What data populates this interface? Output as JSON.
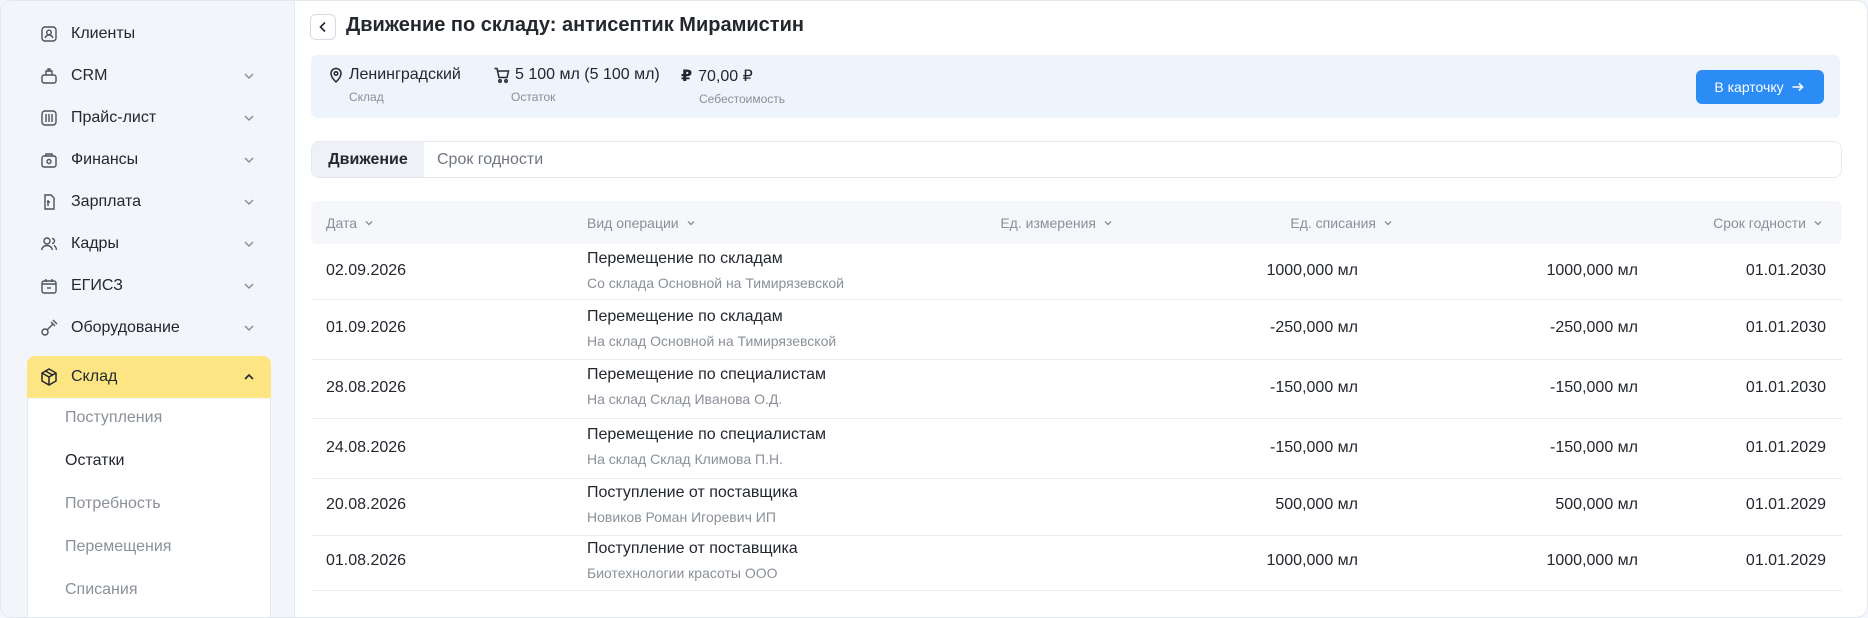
{
  "sidebar": {
    "items": [
      {
        "label": "Клиенты",
        "icon": "clients-icon",
        "has_chevron": false
      },
      {
        "label": "CRM",
        "icon": "crm-icon",
        "has_chevron": true
      },
      {
        "label": "Прайс-лист",
        "icon": "price-list-icon",
        "has_chevron": true
      },
      {
        "label": "Финансы",
        "icon": "finance-icon",
        "has_chevron": true
      },
      {
        "label": "Зарплата",
        "icon": "salary-icon",
        "has_chevron": true
      },
      {
        "label": "Кадры",
        "icon": "staff-icon",
        "has_chevron": true
      },
      {
        "label": "ЕГИСЗ",
        "icon": "egisz-icon",
        "has_chevron": true
      },
      {
        "label": "Оборудование",
        "icon": "equipment-icon",
        "has_chevron": true
      },
      {
        "label": "Склад",
        "icon": "warehouse-icon",
        "has_chevron": true,
        "active": true
      }
    ],
    "submenu": [
      {
        "label": "Поступления"
      },
      {
        "label": "Остатки",
        "current": true
      },
      {
        "label": "Потребность"
      },
      {
        "label": "Перемещения"
      },
      {
        "label": "Списания"
      }
    ]
  },
  "header": {
    "title": "Движение по складу: антисептик Мирамистин"
  },
  "info": {
    "warehouse_value": "Ленинградский",
    "warehouse_label": "Склад",
    "stock_value": "5 100 мл (5 100 мл)",
    "stock_label": "Остаток",
    "cost_value": "70,00 ₽",
    "cost_label": "Себестоимость",
    "card_button": "В карточку"
  },
  "tabs": {
    "movement": "Движение",
    "expiry": "Срок годности"
  },
  "table": {
    "columns": {
      "date": "Дата",
      "operation": "Вид операции",
      "unit": "Ед. измерения",
      "writeoff": "Ед. списания",
      "expiry": "Срок годности"
    },
    "rows": [
      {
        "date": "02.09.2026",
        "op": "Перемещение по складам",
        "op_sub": "Со склада Основной на Тимирязевской",
        "unit": "1000,000 мл",
        "writeoff": "1000,000 мл",
        "expiry": "01.01.2030"
      },
      {
        "date": "01.09.2026",
        "op": "Перемещение по складам",
        "op_sub": "На склад Основной на Тимирязевской",
        "unit": "-250,000 мл",
        "writeoff": "-250,000 мл",
        "expiry": "01.01.2030"
      },
      {
        "date": "28.08.2026",
        "op": "Перемещение по специалистам",
        "op_sub": "На склад Склад Иванова О.Д.",
        "unit": "-150,000 мл",
        "writeoff": "-150,000 мл",
        "expiry": "01.01.2030"
      },
      {
        "date": "24.08.2026",
        "op": "Перемещение по специалистам",
        "op_sub": "На склад Склад Климова П.Н.",
        "unit": "-150,000 мл",
        "writeoff": "-150,000 мл",
        "expiry": "01.01.2029"
      },
      {
        "date": "20.08.2026",
        "op": "Поступление от поставщика",
        "op_sub": "Новиков Роман Игоревич ИП",
        "unit": "500,000 мл",
        "writeoff": "500,000 мл",
        "expiry": "01.01.2029"
      },
      {
        "date": "01.08.2026",
        "op": "Поступление от поставщика",
        "op_sub": "Биотехнологии красоты ООО",
        "unit": "1000,000 мл",
        "writeoff": "1000,000 мл",
        "expiry": "01.01.2029"
      }
    ]
  },
  "colors": {
    "accent": "#2b8cf5",
    "active_nav": "#fde584",
    "info_bg": "#eef4fb"
  }
}
